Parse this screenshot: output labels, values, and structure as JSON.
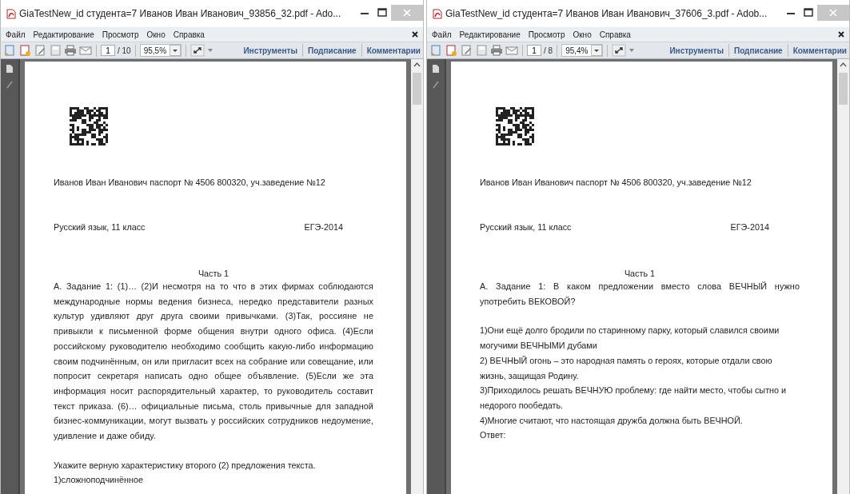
{
  "windows": [
    {
      "title": "GiaTestNew_id студента=7 Иванов Иван Иванович_93856_32.pdf - Ado...",
      "menu": [
        "Файл",
        "Редактирование",
        "Просмотр",
        "Окно",
        "Справка"
      ],
      "toolbar": {
        "page": "1",
        "page_count": "/ 10",
        "zoom": "95,5%",
        "links": [
          "Инструменты",
          "Подписание",
          "Комментарии"
        ]
      },
      "document": {
        "header": "Иванов Иван Иванович паспорт № 4506 800320, уч.заведение №12",
        "subject": "Русский язык, 11 класс",
        "exam": "ЕГЭ-2014",
        "part": "Часть 1",
        "paragraphs": [
          {
            "kind": "task",
            "text": "А. Задание 1:  (1)… (2)И несмотря на то что в этих фирмах соблюдаются международные нормы ведения бизнеса, нередко представители разных культур удивляют друг друга своими привычками. (3)Так, россияне не привыкли к письменной форме общения внутри одного офиса. (4)Если российскому руководителю необходимо сообщить какую-либо информацию своим подчинённым, он или пригласит всех на собрание или совещание, или попросит секретаря написать одно общее объявление. (5)Если же эта информация носит распорядительный характер, то руководитель составит текст приказа. (6)… официальные письма, столь привычные для западной бизнес-коммуникации, могут вызвать у российских сотрудников недоумение, удивление и даже обиду."
          },
          {
            "kind": "line",
            "text": "Укажите верную характеристику второго (2) предложения текста."
          },
          {
            "kind": "line",
            "text": "1)сложноподчинённое"
          }
        ]
      }
    },
    {
      "title": "GiaTestNew_id студента=7 Иванов Иван Иванович_37606_3.pdf - Adob...",
      "menu": [
        "Файл",
        "Редактирование",
        "Просмотр",
        "Окно",
        "Справка"
      ],
      "toolbar": {
        "page": "1",
        "page_count": "/ 8",
        "zoom": "95,4%",
        "links": [
          "Инструменты",
          "Подписание",
          "Комментарии"
        ]
      },
      "document": {
        "header": "Иванов Иван Иванович паспорт № 4506 800320, уч.заведение №12",
        "subject": "Русский язык, 11 класс",
        "exam": "ЕГЭ-2014",
        "part": "Часть 1",
        "paragraphs": [
          {
            "kind": "task",
            "text": "А. Задание 1:  В каком предложении вместо слова ВЕЧНЫЙ нужно употребить ВЕКОВОЙ?"
          },
          {
            "kind": "line",
            "text": "1)Они ещё долго бродили по старинному парку, который славился  своими могучими ВЕЧНЫМИ дубами"
          },
          {
            "kind": "line",
            "text": "2) ВЕЧНЫЙ огонь – это народная память о героях, которые отдали свою жизнь, защищая Родину."
          },
          {
            "kind": "line",
            "text": "3)Приходилось решать ВЕЧНУЮ проблему: где найти место, чтобы сытно и недорого пообедать."
          },
          {
            "kind": "line",
            "text": "4)Многие считают, что настоящая дружба должна быть ВЕЧНОЙ."
          },
          {
            "kind": "line",
            "text": "Ответ:"
          }
        ]
      }
    }
  ]
}
